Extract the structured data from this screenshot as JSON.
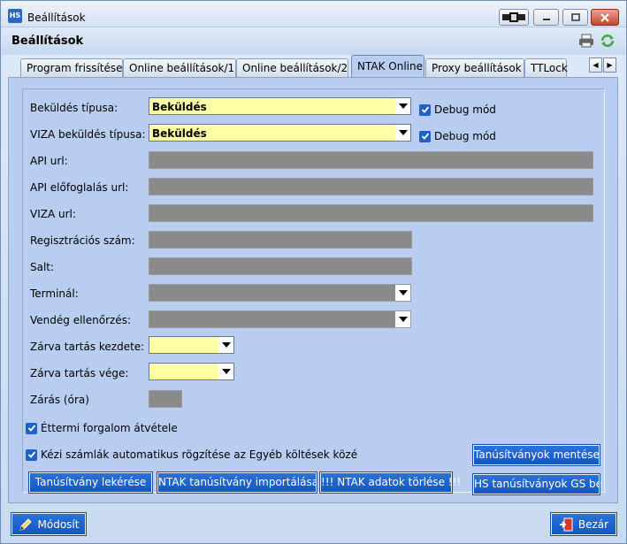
{
  "window": {
    "title": "Beállítások",
    "app_icon_text": "HS"
  },
  "header": {
    "title": "Beállítások",
    "icons": [
      "printer-icon",
      "refresh-icon"
    ]
  },
  "tabs": [
    {
      "label": "Program frissítése",
      "active": false
    },
    {
      "label": "Online beállítások/1",
      "active": false
    },
    {
      "label": "Online beállítások/2",
      "active": false
    },
    {
      "label": "NTAK Online",
      "active": true
    },
    {
      "label": "Proxy beállítások",
      "active": false
    },
    {
      "label": "TTLock",
      "active": false
    }
  ],
  "form": {
    "kuldes_tipus": {
      "label": "Beküldés típusa:",
      "value": "Beküldés"
    },
    "viza_kuldes_tipus": {
      "label": "VIZA beküldés típusa:",
      "value": "Beküldés"
    },
    "debug1": {
      "label": "Debug mód",
      "checked": true
    },
    "debug2": {
      "label": "Debug mód",
      "checked": true
    },
    "api_url": {
      "label": "API url:",
      "value": ""
    },
    "api_elofoglalas_url": {
      "label": "API előfoglalás url:",
      "value": ""
    },
    "viza_url": {
      "label": "VIZA url:",
      "value": ""
    },
    "regisztracios_szam": {
      "label": "Regisztrációs szám:",
      "value": ""
    },
    "salt": {
      "label": "Salt:",
      "value": ""
    },
    "terminal": {
      "label": "Terminál:",
      "value": ""
    },
    "vendeg_ellenorzes": {
      "label": "Vendég ellenőrzés:",
      "value": ""
    },
    "zarva_kezdete": {
      "label": "Zárva tartás kezdete:",
      "value": ""
    },
    "zarva_vege": {
      "label": "Zárva tartás vége:",
      "value": ""
    },
    "zaras_ora": {
      "label": "Zárás (óra)",
      "value": ""
    },
    "ettermi": {
      "label": "Éttermi forgalom átvétele",
      "checked": true
    },
    "kezi_szamlak": {
      "label": "Kézi számlák automatikus rögzítése az Egyéb költések közé",
      "checked": true
    }
  },
  "buttons": {
    "tanusitvanyok_mentese": "Tanúsítványok mentése",
    "tanusitvany_lekerese": "Tanúsítvány lekérése",
    "ntak_import": "NTAK tanúsítvány importálása",
    "ntak_torles": "!!! NTAK adatok törlése !!!",
    "hs_tanusitvanyok": "HS tanúsítványok GS be",
    "modosit": "Módosít",
    "bezar": "Bezár"
  },
  "colors": {
    "accent_button": "#1f61c6",
    "panel_bg": "#b8cdef",
    "yellow_input": "#ffffa6",
    "disabled_input": "#8a8a8a"
  }
}
